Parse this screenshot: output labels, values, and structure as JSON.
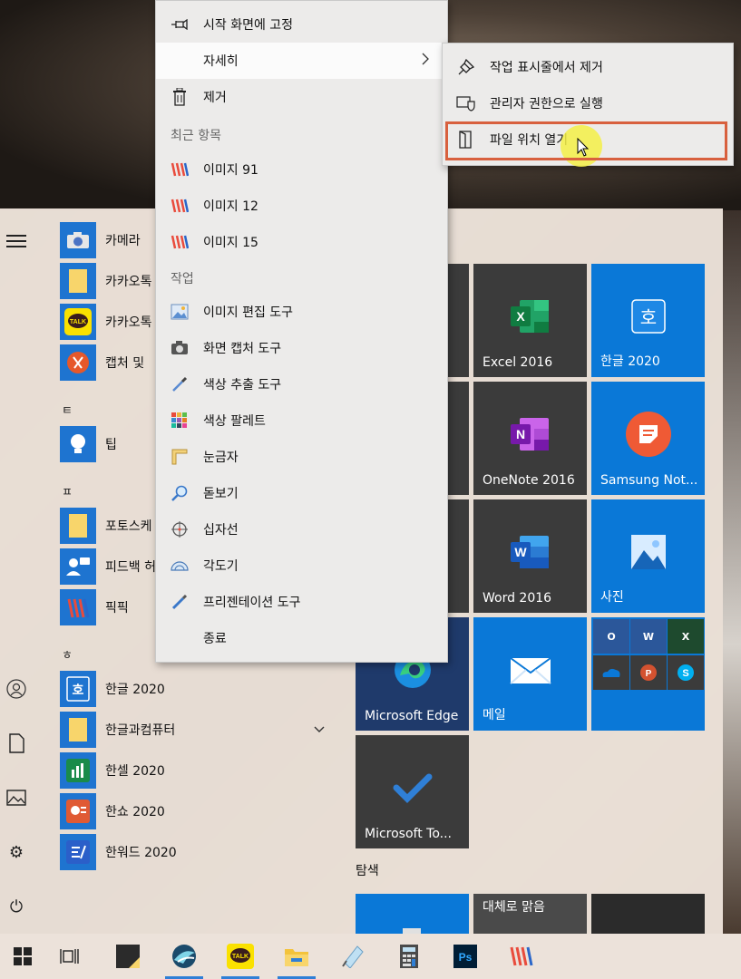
{
  "context_menu": {
    "pin_label": "시작 화면에 고정",
    "more_label": "자세히",
    "delete_label": "제거",
    "recent_header": "최근 항목",
    "recent": [
      "이미지 91",
      "이미지 12",
      "이미지 15"
    ],
    "tasks_header": "작업",
    "tasks": [
      "이미지 편집 도구",
      "화면 캡처 도구",
      "색상 추출 도구",
      "색상 팔레트",
      "눈금자",
      "돋보기",
      "십자선",
      "각도기",
      "프리젠테이션 도구"
    ],
    "exit_label": "종료"
  },
  "submenu": {
    "unpin_taskbar": "작업 표시줄에서 제거",
    "run_admin": "관리자 권한으로 실행",
    "open_location": "파일 위치 열기"
  },
  "app_list": {
    "apps": [
      "카메라",
      "카카오톡",
      "카카오톡",
      "캡처 및"
    ],
    "letter_t": "ㅌ",
    "tip": "팁",
    "letter_p": "ㅍ",
    "apps_p": [
      "포토스케",
      "피드백 허",
      "픽픽"
    ],
    "letter_h": "ㅎ",
    "apps_h": [
      "한글 2020",
      "한글과컴퓨터",
      "한셀 2020",
      "한쇼 2020",
      "한워드 2020"
    ]
  },
  "tiles": {
    "excel": "Excel 2016",
    "hangul": "한글 2020",
    "onenote": "OneNote 2016",
    "samsung": "Samsung Not...",
    "word": "Word 2016",
    "photos": "사진",
    "edge": "Microsoft Edge",
    "mail": "메일",
    "todo": "Microsoft To...",
    "explore_header": "탐색",
    "fit": "대체로 맑음"
  },
  "colors": {
    "tile_blue": "#0a78d7",
    "tile_dark": "#3b3b3b",
    "highlight_border": "#d8603e"
  }
}
